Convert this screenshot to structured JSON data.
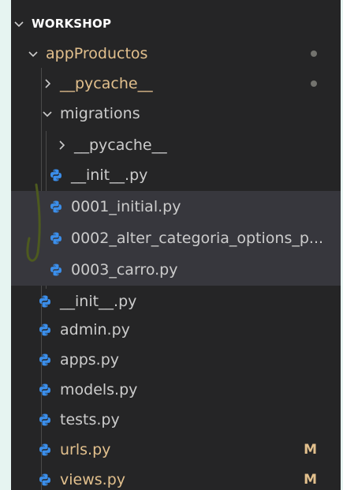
{
  "explorer": {
    "workspace_title": "WORKSHOP",
    "tree": [
      {
        "label": "appProductos",
        "type": "folder",
        "expanded": true,
        "decoration": "dot"
      },
      {
        "label": "__pycache__",
        "type": "folder",
        "expanded": false,
        "decoration": "dot"
      },
      {
        "label": "migrations",
        "type": "folder",
        "expanded": true
      },
      {
        "label": "__pycache__",
        "type": "folder",
        "expanded": false
      },
      {
        "label": "__init__.py",
        "type": "python-file"
      },
      {
        "label": "0001_initial.py",
        "type": "python-file"
      },
      {
        "label": "0002_alter_categoria_options_p...",
        "type": "python-file"
      },
      {
        "label": "0003_carro.py",
        "type": "python-file"
      },
      {
        "label": "__init__.py",
        "type": "python-file"
      },
      {
        "label": "admin.py",
        "type": "python-file"
      },
      {
        "label": "apps.py",
        "type": "python-file"
      },
      {
        "label": "models.py",
        "type": "python-file"
      },
      {
        "label": "tests.py",
        "type": "python-file"
      },
      {
        "label": "urls.py",
        "type": "python-file",
        "badge": "M"
      },
      {
        "label": "views.py",
        "type": "python-file",
        "badge": "M"
      }
    ]
  },
  "colors": {
    "sidebar_bg": "#252526",
    "selection_bg": "#37373d",
    "modified": "#e2c08d",
    "python_icon": "#3b8eea"
  }
}
